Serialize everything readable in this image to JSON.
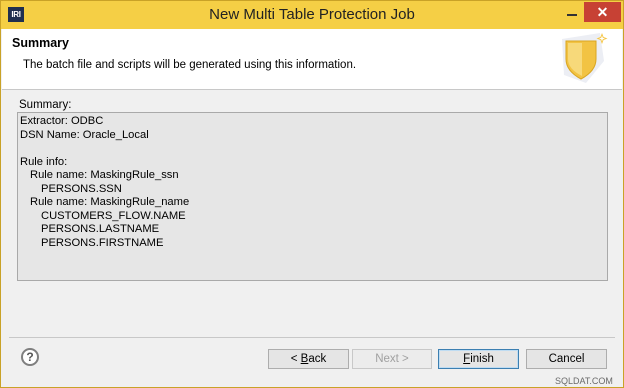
{
  "window": {
    "app_icon_text": "IRI",
    "title": "New Multi Table Protection Job",
    "close_symbol": "✕"
  },
  "header": {
    "title": "Summary",
    "description": "The batch file and scripts will be generated using this information."
  },
  "summary": {
    "label": "Summary:",
    "extractor": "Extractor: ODBC",
    "dsn": "DSN Name: Oracle_Local",
    "rule_info_label": "Rule info:",
    "rules": [
      {
        "name_line": "Rule name: MaskingRule_ssn",
        "columns": [
          "PERSONS.SSN"
        ]
      },
      {
        "name_line": "Rule name: MaskingRule_name",
        "columns": [
          "CUSTOMERS_FLOW.NAME",
          "PERSONS.LASTNAME",
          "PERSONS.FIRSTNAME"
        ]
      }
    ]
  },
  "footer": {
    "help_symbol": "?",
    "back": {
      "prefix": "< ",
      "mnemonic": "B",
      "rest": "ack",
      "enabled": true
    },
    "next": {
      "label": "Next >",
      "enabled": false
    },
    "finish": {
      "mnemonic": "F",
      "rest": "inish",
      "enabled": true
    },
    "cancel": {
      "label": "Cancel",
      "enabled": true
    }
  },
  "watermark": "SQLDAT.COM",
  "colors": {
    "titlebar": "#f5cf45",
    "close_button": "#c74134",
    "summary_background": "#e6e6e6",
    "shield": "#f2c343"
  }
}
